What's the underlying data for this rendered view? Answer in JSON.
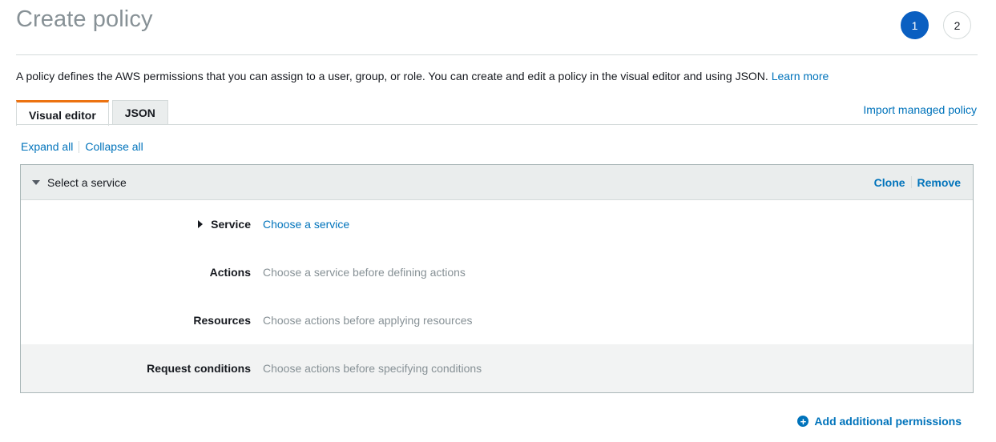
{
  "page": {
    "title": "Create policy"
  },
  "steps": [
    {
      "label": "1",
      "active": true
    },
    {
      "label": "2",
      "active": false
    }
  ],
  "description": {
    "text": "A policy defines the AWS permissions that you can assign to a user, group, or role. You can create and edit a policy in the visual editor and using JSON.",
    "learn_more": "Learn more"
  },
  "tabs": [
    {
      "label": "Visual editor",
      "active": true
    },
    {
      "label": "JSON",
      "active": false
    }
  ],
  "import_link": "Import managed policy",
  "expand_all": "Expand all",
  "collapse_all": "Collapse all",
  "panel": {
    "header": "Select a service",
    "clone": "Clone",
    "remove": "Remove",
    "rows": [
      {
        "label": "Service",
        "value": "Choose a service"
      },
      {
        "label": "Actions",
        "value": "Choose a service before defining actions"
      },
      {
        "label": "Resources",
        "value": "Choose actions before applying resources"
      },
      {
        "label": "Request conditions",
        "value": "Choose actions before specifying conditions"
      }
    ]
  },
  "add_permissions": "Add additional permissions",
  "colors": {
    "accent_blue": "#0073bb",
    "step_active": "#0a5fc1",
    "tab_active_border": "#ec7211",
    "muted_text": "#879196"
  }
}
